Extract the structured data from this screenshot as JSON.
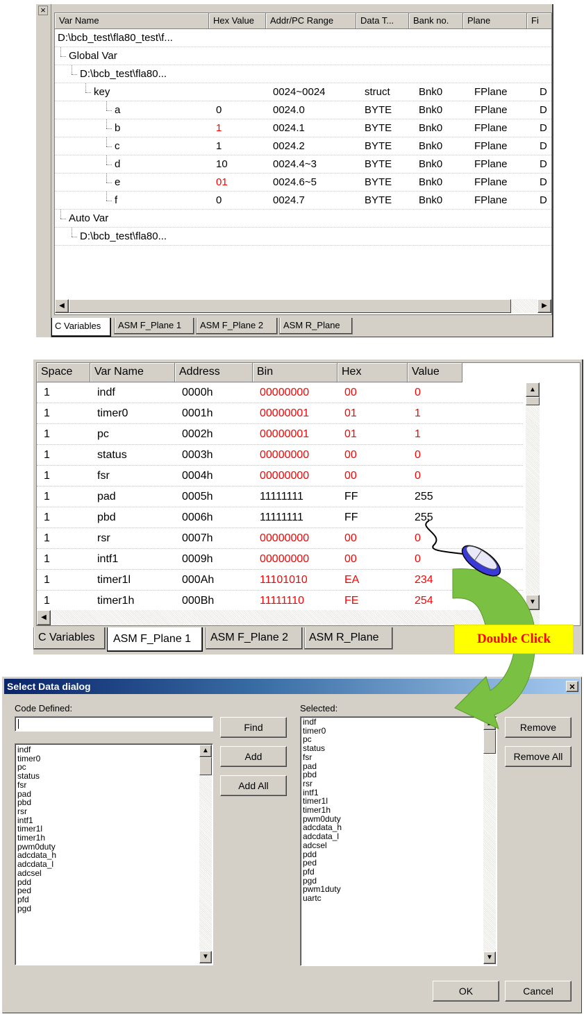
{
  "panel1": {
    "columns": [
      "Var Name",
      "Hex Value",
      "Addr/PC Range",
      "Data T...",
      "Bank no.",
      "Plane",
      "Fi"
    ],
    "rows": [
      {
        "name": "D:\\bcb_test\\fla80_test\\f...",
        "hex": "",
        "addr": "",
        "type": "",
        "bank": "",
        "plane": "",
        "fi": ""
      },
      {
        "name": "Global Var",
        "hex": "",
        "addr": "",
        "type": "",
        "bank": "",
        "plane": "",
        "fi": ""
      },
      {
        "name": "D:\\bcb_test\\fla80...",
        "hex": "",
        "addr": "",
        "type": "",
        "bank": "",
        "plane": "",
        "fi": ""
      },
      {
        "name": "key",
        "hex": "",
        "addr": "0024~0024",
        "type": "struct",
        "bank": "Bnk0",
        "plane": "FPlane",
        "fi": "D"
      },
      {
        "name": "a",
        "hex": "0",
        "addr": "0024.0",
        "type": "BYTE",
        "bank": "Bnk0",
        "plane": "FPlane",
        "fi": "D"
      },
      {
        "name": "b",
        "hex": "1",
        "addr": "0024.1",
        "type": "BYTE",
        "bank": "Bnk0",
        "plane": "FPlane",
        "fi": "D"
      },
      {
        "name": "c",
        "hex": "1",
        "addr": "0024.2",
        "type": "BYTE",
        "bank": "Bnk0",
        "plane": "FPlane",
        "fi": "D"
      },
      {
        "name": "d",
        "hex": "10",
        "addr": "0024.4~3",
        "type": "BYTE",
        "bank": "Bnk0",
        "plane": "FPlane",
        "fi": "D"
      },
      {
        "name": "e",
        "hex": "01",
        "addr": "0024.6~5",
        "type": "BYTE",
        "bank": "Bnk0",
        "plane": "FPlane",
        "fi": "D"
      },
      {
        "name": "f",
        "hex": "0",
        "addr": "0024.7",
        "type": "BYTE",
        "bank": "Bnk0",
        "plane": "FPlane",
        "fi": "D"
      },
      {
        "name": "Auto Var",
        "hex": "",
        "addr": "",
        "type": "",
        "bank": "",
        "plane": "",
        "fi": ""
      },
      {
        "name": "D:\\bcb_test\\fla80...",
        "hex": "",
        "addr": "",
        "type": "",
        "bank": "",
        "plane": "",
        "fi": ""
      }
    ],
    "close_glyph": "×",
    "tabs": [
      "C Variables",
      "ASM F_Plane 1",
      "ASM F_Plane 2",
      "ASM R_Plane"
    ]
  },
  "panel2": {
    "columns": [
      "Space",
      "Var Name",
      "Address",
      "Bin",
      "Hex",
      "Value"
    ],
    "rows": [
      {
        "space": "1",
        "name": "indf",
        "addr": "0000h",
        "bin": "00000000",
        "hex": "00",
        "value": "0"
      },
      {
        "space": "1",
        "name": "timer0",
        "addr": "0001h",
        "bin": "00000001",
        "hex": "01",
        "value": "1"
      },
      {
        "space": "1",
        "name": "pc",
        "addr": "0002h",
        "bin": "00000001",
        "hex": "01",
        "value": "1"
      },
      {
        "space": "1",
        "name": "status",
        "addr": "0003h",
        "bin": "00000000",
        "hex": "00",
        "value": "0"
      },
      {
        "space": "1",
        "name": "fsr",
        "addr": "0004h",
        "bin": "00000000",
        "hex": "00",
        "value": "0"
      },
      {
        "space": "1",
        "name": "pad",
        "addr": "0005h",
        "bin": "11111111",
        "hex": "FF",
        "value": "255"
      },
      {
        "space": "1",
        "name": "pbd",
        "addr": "0006h",
        "bin": "11111111",
        "hex": "FF",
        "value": "255"
      },
      {
        "space": "1",
        "name": "rsr",
        "addr": "0007h",
        "bin": "00000000",
        "hex": "00",
        "value": "0"
      },
      {
        "space": "1",
        "name": "intf1",
        "addr": "0009h",
        "bin": "00000000",
        "hex": "00",
        "value": "0"
      },
      {
        "space": "1",
        "name": "timer1l",
        "addr": "000Ah",
        "bin": "11101010",
        "hex": "EA",
        "value": "234"
      },
      {
        "space": "1",
        "name": "timer1h",
        "addr": "000Bh",
        "bin": "11111110",
        "hex": "FE",
        "value": "254"
      }
    ],
    "tabs": [
      "C Variables",
      "ASM F_Plane 1",
      "ASM F_Plane 2",
      "ASM R_Plane"
    ]
  },
  "callout": {
    "label": "Double Click",
    "color": "#ff0000",
    "bg": "#ffff00"
  },
  "dialog": {
    "title": "Select Data dialog",
    "close_glyph": "×",
    "code_defined_label": "Code Defined:",
    "selected_label": "Selected:",
    "input_value": "",
    "buttons": {
      "find": "Find",
      "add": "Add",
      "add_all": "Add All",
      "remove": "Remove",
      "remove_all": "Remove All",
      "ok": "OK",
      "cancel": "Cancel"
    },
    "left_items": [
      "indf",
      "timer0",
      "pc",
      "status",
      "fsr",
      "pad",
      "pbd",
      "rsr",
      "intf1",
      "timer1l",
      "timer1h",
      "pwm0duty",
      "adcdata_h",
      "adcdata_l",
      "adcsel",
      "pdd",
      "ped",
      "pfd",
      "pgd"
    ],
    "right_items": [
      "indf",
      "timer0",
      "pc",
      "status",
      "fsr",
      "pad",
      "pbd",
      "rsr",
      "intf1",
      "timer1l",
      "timer1h",
      "pwm0duty",
      "adcdata_h",
      "adcdata_l",
      "adcsel",
      "pdd",
      "ped",
      "pfd",
      "pgd",
      "pwm1duty",
      "uartc"
    ]
  },
  "colors": {
    "accent_red": "#ff0000",
    "face": "#d4d0c8",
    "title_blue": "#0a246a",
    "arrow_green": "#7ac143"
  }
}
